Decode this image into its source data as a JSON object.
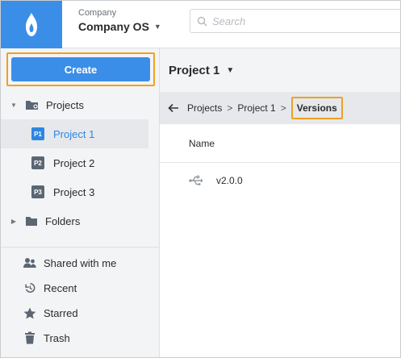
{
  "header": {
    "company_label": "Company",
    "company_name": "Company OS",
    "search_placeholder": "Search"
  },
  "sidebar": {
    "create_label": "Create",
    "items": [
      {
        "label": "Projects",
        "icon": "folder-settings-icon",
        "expanded": true
      },
      {
        "label": "Project 1",
        "badge": "P1",
        "selected": true
      },
      {
        "label": "Project 2",
        "badge": "P2"
      },
      {
        "label": "Project 3",
        "badge": "P3"
      },
      {
        "label": "Folders",
        "icon": "folder-icon",
        "expanded": false
      }
    ],
    "secondary": [
      {
        "label": "Shared with me",
        "icon": "users-icon"
      },
      {
        "label": "Recent",
        "icon": "history-icon"
      },
      {
        "label": "Starred",
        "icon": "star-icon"
      },
      {
        "label": "Trash",
        "icon": "trash-icon"
      }
    ]
  },
  "main": {
    "project_title": "Project 1",
    "breadcrumb": [
      "Projects",
      "Project 1",
      "Versions"
    ],
    "breadcrumb_separator": ">",
    "column_name": "Name",
    "rows": [
      {
        "name": "v2.0.0",
        "icon": "usb-branch-icon"
      }
    ]
  },
  "colors": {
    "brand": "#3b8ee8",
    "highlight": "#f0a022",
    "selected_text": "#2f86e0"
  }
}
